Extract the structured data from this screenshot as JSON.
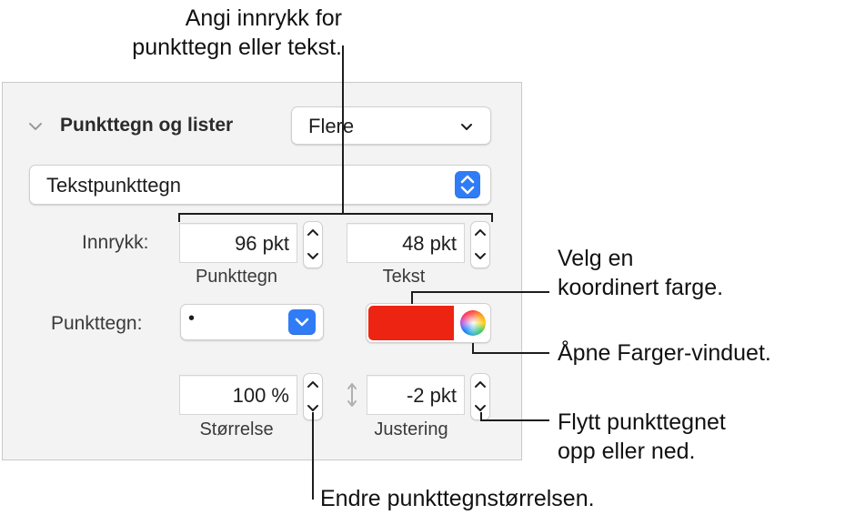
{
  "panel": {
    "section_title": "Punkttegn og lister",
    "preset_popup": "Flere",
    "style_popup": "Tekstpunkttegn",
    "indent": {
      "label": "Innrykk:",
      "bullet_value": "96 pkt",
      "bullet_caption": "Punkttegn",
      "text_value": "48 pkt",
      "text_caption": "Tekst"
    },
    "bullet": {
      "label": "Punkttegn:",
      "glyph": "•",
      "color": "#ee2412"
    },
    "size": {
      "value": "100 %",
      "caption": "Størrelse"
    },
    "align": {
      "value": "-2 pkt",
      "caption": "Justering"
    }
  },
  "callouts": {
    "indent_line1": "Angi innrykk for",
    "indent_line2": "punkttegn eller tekst.",
    "color_line1": "Velg en",
    "color_line2": "koordinert farge.",
    "colors_window": "Åpne Farger-vinduet.",
    "move_line1": "Flytt punkttegnet",
    "move_line2": "opp eller ned.",
    "size": "Endre punkttegnstørrelsen."
  },
  "colors": {
    "accent_blue": "#2f7cf6",
    "panel_bg": "#f3f3f3"
  }
}
